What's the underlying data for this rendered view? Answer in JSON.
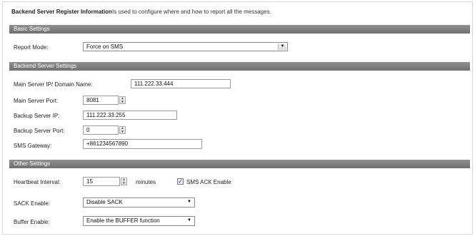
{
  "header": {
    "title": "Backend Server Register Information",
    "description": "Is used to configure where and how to report all the messages."
  },
  "sections": {
    "basic": "Basic Settings",
    "backend": "Backend Server Settings",
    "other": "Other Settings"
  },
  "basic": {
    "report_mode_label": "Report Mode:",
    "report_mode_value": "Force on SMS"
  },
  "backend": {
    "main_ip_label": "Main Server IP/ Domain Name:",
    "main_ip_value": "111.222.33.444",
    "main_port_label": "Main Server Port:",
    "main_port_value": "8081",
    "backup_ip_label": "Backup Server IP:",
    "backup_ip_value": "111.222.33.255",
    "backup_port_label": "Backup Server Port:",
    "backup_port_value": "0",
    "sms_gateway_label": "SMS Gateway:",
    "sms_gateway_value": "+861234567890"
  },
  "other": {
    "heartbeat_label": "Heartbeat Interval:",
    "heartbeat_value": "15",
    "heartbeat_unit": "minutes",
    "sms_ack_label": "SMS ACK Enable",
    "sms_ack_checked": true,
    "sack_label": "SACK Enable:",
    "sack_value": "Disable SACK",
    "buffer_label": "Buffer Enable:",
    "buffer_value": "Enable the BUFFER function"
  },
  "icons": {
    "dropdown": "chevron-down-icon",
    "spinner": "spinner-arrows-icon",
    "checkbox": "checkmark-icon"
  }
}
